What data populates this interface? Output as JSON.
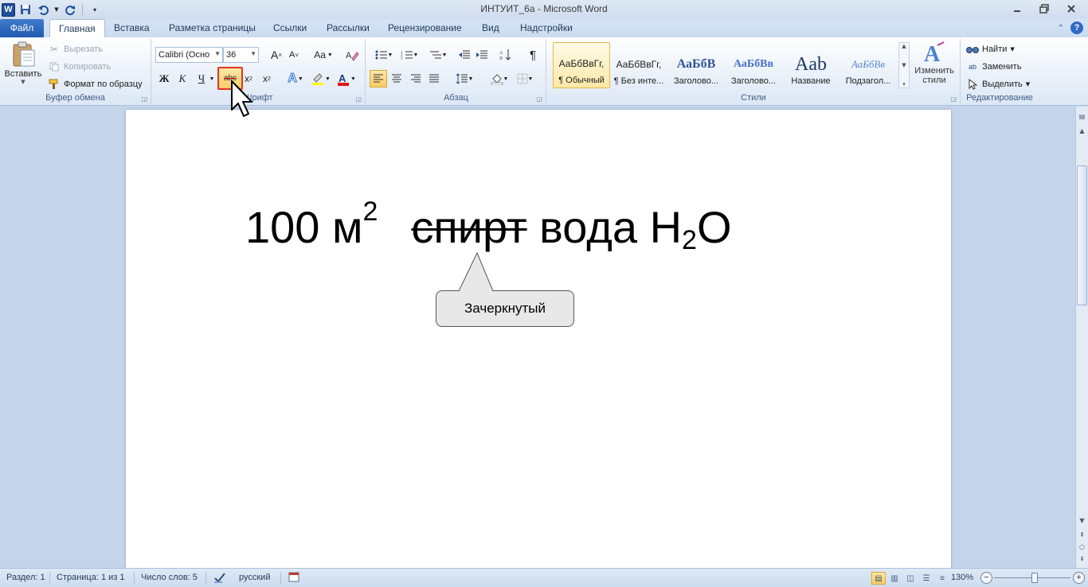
{
  "window": {
    "title": "ИНТУИТ_6а - Microsoft Word",
    "app_icon": "W"
  },
  "tabs": [
    {
      "label": "Файл"
    },
    {
      "label": "Главная"
    },
    {
      "label": "Вставка"
    },
    {
      "label": "Разметка страницы"
    },
    {
      "label": "Ссылки"
    },
    {
      "label": "Рассылки"
    },
    {
      "label": "Рецензирование"
    },
    {
      "label": "Вид"
    },
    {
      "label": "Надстройки"
    }
  ],
  "clipboard": {
    "paste_label": "Вставить",
    "cut_label": "Вырезать",
    "copy_label": "Копировать",
    "format_painter_label": "Формат по образцу",
    "group_label": "Буфер обмена"
  },
  "font": {
    "font_name": "Calibri (Осно",
    "font_size": "36",
    "group_label": "Шрифт",
    "bold": "Ж",
    "italic": "К",
    "underline": "Ч",
    "strike": "abc",
    "grow": "A",
    "shrink": "A",
    "case": "Aa",
    "subscript": "x",
    "superscript": "x"
  },
  "paragraph": {
    "group_label": "Абзац"
  },
  "styles": {
    "group_label": "Стили",
    "items": [
      {
        "sample": "АаБбВвГг,",
        "name": "¶ Обычный"
      },
      {
        "sample": "АаБбВвГг,",
        "name": "¶ Без инте..."
      },
      {
        "sample": "АаБбВ",
        "name": "Заголово..."
      },
      {
        "sample": "АаБбВв",
        "name": "Заголово..."
      },
      {
        "sample": "Aab",
        "name": "Название"
      },
      {
        "sample": "АаБбВв",
        "name": "Подзагол..."
      }
    ],
    "change_styles_label_1": "Изменить",
    "change_styles_label_2": "стили"
  },
  "editing": {
    "find_label": "Найти",
    "replace_label": "Заменить",
    "select_label": "Выделить",
    "group_label": "Редактирование"
  },
  "document": {
    "number": "100 м",
    "superscript": "2",
    "struck_word": "спирт",
    "word_water": "вода H",
    "subscript": "2",
    "tail": "O",
    "callout_text": "Зачеркнутый"
  },
  "status": {
    "section": "Раздел: 1",
    "page": "Страница: 1 из 1",
    "words": "Число слов: 5",
    "language": "русский",
    "zoom": "130%"
  }
}
